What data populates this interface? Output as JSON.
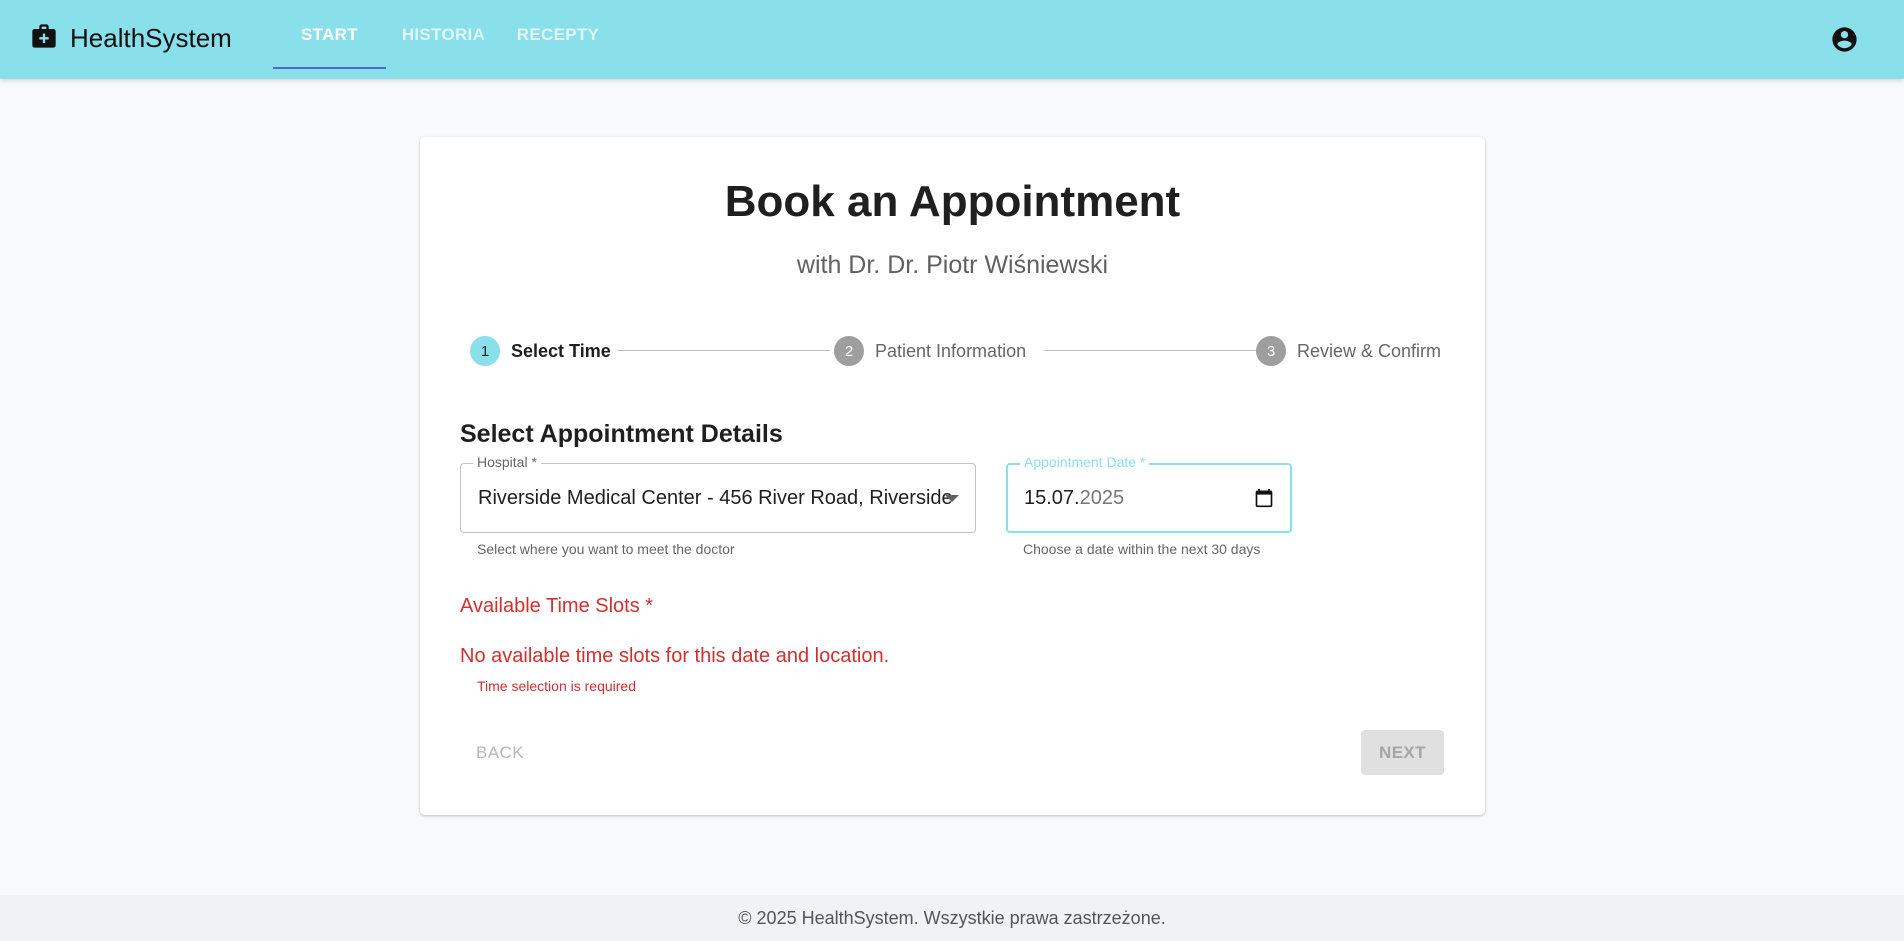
{
  "app": {
    "brand": "HealthSystem",
    "accent_color": "#89dfea",
    "icons": {
      "brand": "medical-briefcase-icon",
      "account": "account-circle-icon"
    }
  },
  "nav": {
    "tabs": [
      {
        "label": "START",
        "active": true
      },
      {
        "label": "HISTORIA",
        "active": false
      },
      {
        "label": "RECEPTY",
        "active": false
      }
    ]
  },
  "page": {
    "title": "Book an Appointment",
    "subtitle": "with Dr. Dr. Piotr Wiśniewski"
  },
  "stepper": {
    "steps": [
      {
        "number": "1",
        "label": "Select Time",
        "active": true
      },
      {
        "number": "2",
        "label": "Patient Information",
        "active": false
      },
      {
        "number": "3",
        "label": "Review & Confirm",
        "active": false
      }
    ]
  },
  "form": {
    "section_title": "Select Appointment Details",
    "hospital": {
      "label": "Hospital *",
      "value": "Riverside Medical Center - 456 River Road, Riverside",
      "helper": "Select where you want to meet the doctor"
    },
    "date": {
      "label": "Appointment Date *",
      "value_day_month": "15.07.",
      "value_year": "2025",
      "helper": "Choose a date within the next 30 days"
    },
    "slots": {
      "title": "Available Time Slots *",
      "empty_message": "No available time slots for this date and location.",
      "error": "Time selection is required"
    }
  },
  "actions": {
    "back_label": "BACK",
    "next_label": "NEXT"
  },
  "footer": {
    "text": "© 2025 HealthSystem. Wszystkie prawa zastrzeżone."
  }
}
